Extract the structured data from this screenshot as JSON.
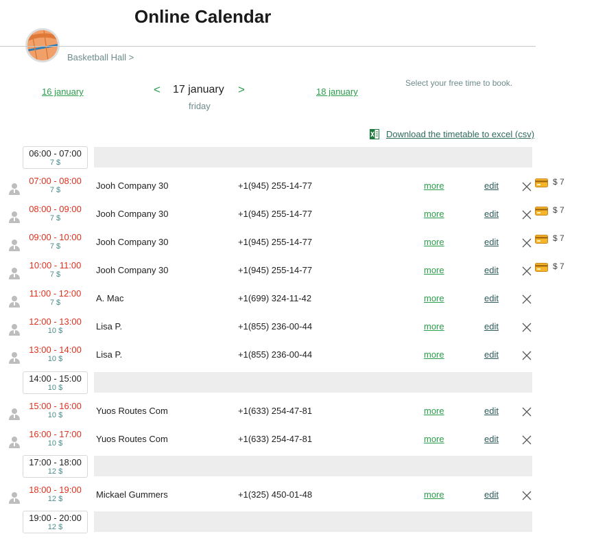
{
  "header": {
    "title": "Online Calendar",
    "hall_link": "Basketball Hall >"
  },
  "date_nav": {
    "prev_day": "16 january",
    "prev_arrow": "<",
    "current_date": "17 january",
    "current_weekday": "friday",
    "next_arrow": ">",
    "next_day": "18 january"
  },
  "hint": "Select your free time to book.",
  "download_link": "Download the timetable to excel (csv)",
  "slots": [
    {
      "time": "06:00 - 07:00",
      "price": "7 $",
      "status": "free"
    },
    {
      "time": "07:00 - 08:00",
      "price": "7 $",
      "status": "booked",
      "name": "Jooh Company 30",
      "phone": "+1(945) 255-14-77",
      "more": "more",
      "edit": "edit",
      "amount": "$ 7"
    },
    {
      "time": "08:00 - 09:00",
      "price": "7 $",
      "status": "booked",
      "name": "Jooh Company 30",
      "phone": "+1(945) 255-14-77",
      "more": "more",
      "edit": "edit",
      "amount": "$ 7"
    },
    {
      "time": "09:00 - 10:00",
      "price": "7 $",
      "status": "booked",
      "name": "Jooh Company 30",
      "phone": "+1(945) 255-14-77",
      "more": "more",
      "edit": "edit",
      "amount": "$ 7"
    },
    {
      "time": "10:00 - 11:00",
      "price": "7 $",
      "status": "booked",
      "name": "Jooh Company 30",
      "phone": "+1(945) 255-14-77",
      "more": "more",
      "edit": "edit",
      "amount": "$ 7"
    },
    {
      "time": "11:00 - 12:00",
      "price": "7 $",
      "status": "booked",
      "name": "A. Mac",
      "phone": "+1(699) 324-11-42",
      "more": "more",
      "edit": "edit"
    },
    {
      "time": "12:00 - 13:00",
      "price": "10 $",
      "status": "booked",
      "name": "Lisa P.",
      "phone": "+1(855) 236-00-44",
      "more": "more",
      "edit": "edit"
    },
    {
      "time": "13:00 - 14:00",
      "price": "10 $",
      "status": "booked",
      "name": "Lisa P.",
      "phone": "+1(855) 236-00-44",
      "more": "more",
      "edit": "edit"
    },
    {
      "time": "14:00 - 15:00",
      "price": "10 $",
      "status": "free"
    },
    {
      "time": "15:00 - 16:00",
      "price": "10 $",
      "status": "booked",
      "name": "Yuos Routes Com",
      "phone": "+1(633) 254-47-81",
      "more": "more",
      "edit": "edit"
    },
    {
      "time": "16:00 - 17:00",
      "price": "10 $",
      "status": "booked",
      "name": "Yuos Routes Com",
      "phone": "+1(633) 254-47-81",
      "more": "more",
      "edit": "edit"
    },
    {
      "time": "17:00 - 18:00",
      "price": "12 $",
      "status": "free"
    },
    {
      "time": "18:00 - 19:00",
      "price": "12 $",
      "status": "booked",
      "name": "Mickael Gummers",
      "phone": "+1(325) 450-01-48",
      "more": "more",
      "edit": "edit"
    },
    {
      "time": "19:00 - 20:00",
      "price": "12 $",
      "status": "free"
    }
  ],
  "colors": {
    "accent": "#2a9d4a",
    "booked_time": "#e0301e",
    "free_bar": "#ededed"
  }
}
